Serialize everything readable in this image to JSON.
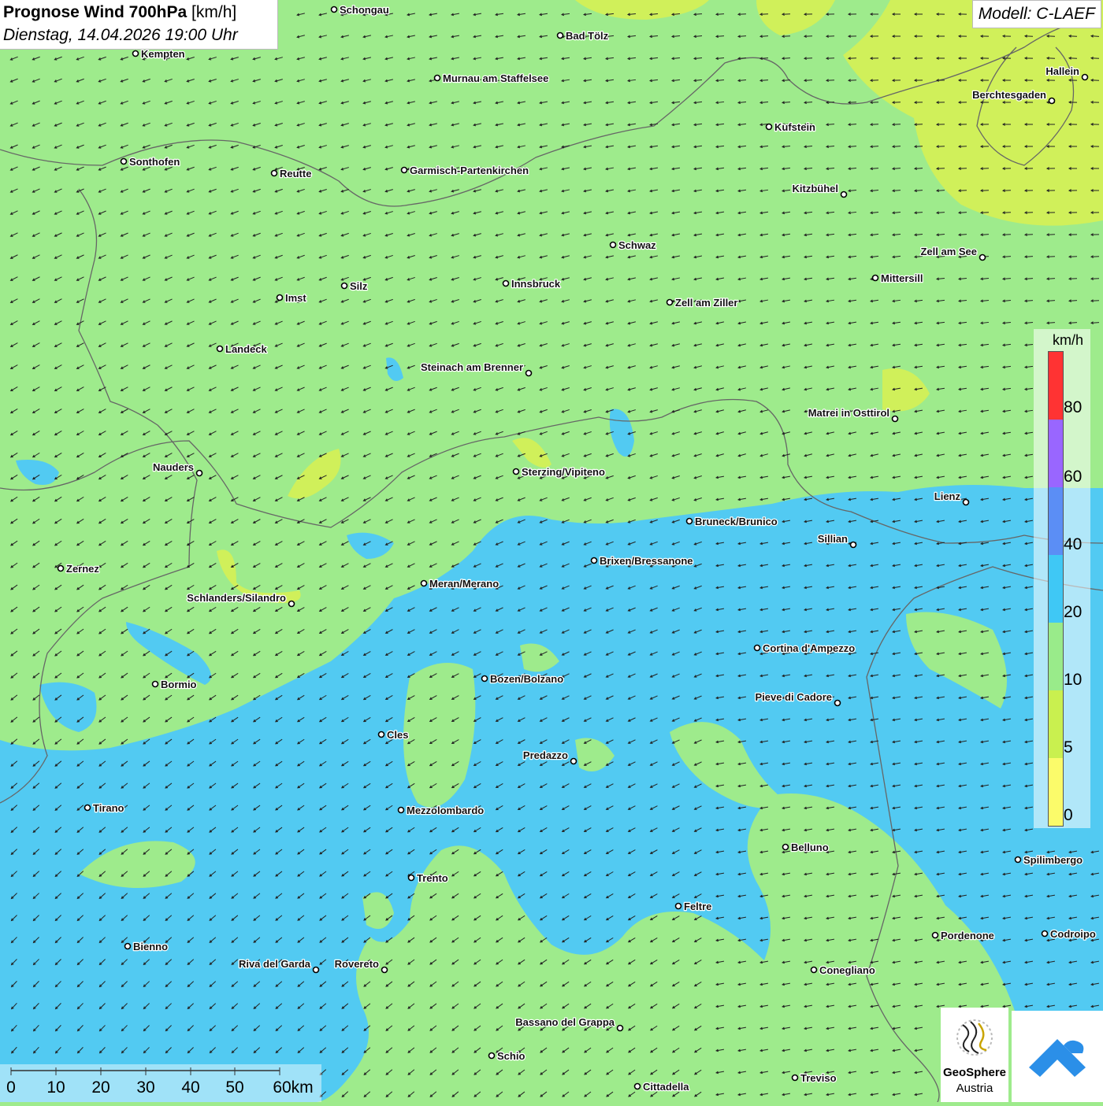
{
  "title": {
    "main": "Prognose Wind 700hPa",
    "unit": "[km/h]",
    "datetime": "Dienstag, 14.04.2026 19:00 Uhr"
  },
  "model": "Modell: C-LAEF",
  "legend": {
    "unit": "km/h",
    "ticks": [
      "80",
      "60",
      "40",
      "20",
      "10",
      "5",
      "0"
    ],
    "colors": [
      "#ff3333",
      "#9966ff",
      "#5b8ef5",
      "#3fc8f5",
      "#99eb8a",
      "#c9f04f",
      "#fbfb6a"
    ]
  },
  "scalebar": {
    "labels": [
      "0",
      "10",
      "20",
      "30",
      "40",
      "50",
      "60km"
    ]
  },
  "logo": {
    "name": "GeoSphere",
    "sub": "Austria"
  },
  "colors": {
    "field_10_20": "#9eeb8c",
    "field_20_40": "#52caf2",
    "field_5_10": "#d0f05a",
    "field_0_5": "#f5f55e"
  },
  "cities": [
    {
      "name": "Schongau"
    },
    {
      "name": "Bad Tölz"
    },
    {
      "name": "Kempten"
    },
    {
      "name": "Murnau am Staffelsee"
    },
    {
      "name": "Hallein"
    },
    {
      "name": "Berchtesgaden"
    },
    {
      "name": "Kufstein"
    },
    {
      "name": "Sonthofen"
    },
    {
      "name": "Reutte"
    },
    {
      "name": "Garmisch-Partenkirchen"
    },
    {
      "name": "Kitzbühel"
    },
    {
      "name": "Schwaz"
    },
    {
      "name": "Zell am See"
    },
    {
      "name": "Mittersill"
    },
    {
      "name": "Silz"
    },
    {
      "name": "Innsbruck"
    },
    {
      "name": "Imst"
    },
    {
      "name": "Zell am Ziller"
    },
    {
      "name": "Landeck"
    },
    {
      "name": "Steinach am Brenner"
    },
    {
      "name": "Matrei in Osttirol"
    },
    {
      "name": "Nauders"
    },
    {
      "name": "Sterzing/Vipiteno"
    },
    {
      "name": "Lienz"
    },
    {
      "name": "Bruneck/Brunico"
    },
    {
      "name": "Sillian"
    },
    {
      "name": "Zernez"
    },
    {
      "name": "Brixen/Bressanone"
    },
    {
      "name": "Meran/Merano"
    },
    {
      "name": "Schlanders/Silandro"
    },
    {
      "name": "Cortina d'Ampezzo"
    },
    {
      "name": "Bozen/Bolzano"
    },
    {
      "name": "Bormio"
    },
    {
      "name": "Pieve di Cadore"
    },
    {
      "name": "Cles"
    },
    {
      "name": "Predazzo"
    },
    {
      "name": "Tirano"
    },
    {
      "name": "Mezzolombardo"
    },
    {
      "name": "Belluno"
    },
    {
      "name": "Spilimbergo"
    },
    {
      "name": "Trento"
    },
    {
      "name": "Feltre"
    },
    {
      "name": "Pordenone"
    },
    {
      "name": "Codroipo"
    },
    {
      "name": "Bienno"
    },
    {
      "name": "Riva del Garda"
    },
    {
      "name": "Rovereto"
    },
    {
      "name": "Conegliano"
    },
    {
      "name": "Bassano del Grappa"
    },
    {
      "name": "Schio"
    },
    {
      "name": "Treviso"
    },
    {
      "name": "Cittadella"
    }
  ]
}
